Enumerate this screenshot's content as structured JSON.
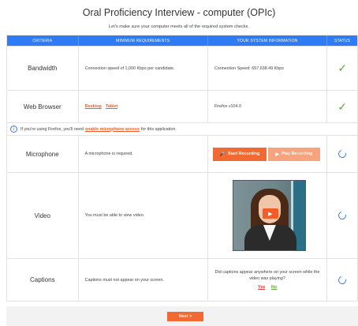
{
  "page": {
    "title": "Oral Proficiency Interview - computer (OPIc)",
    "subtitle": "Let's make sure your computer meets all of the required system checks."
  },
  "table": {
    "headers": {
      "criteria": "CRITERIA",
      "requirements": "MINIMUM REQUIREMENTS",
      "system_info": "YOUR SYSTEM INFORMATION",
      "status": "STATUS"
    },
    "bandwidth": {
      "criteria": "Bandwidth",
      "requirement": "Connection speed of 1,000 Kbps per candidate.",
      "info": "Connection Speed: 657,638.49 Kbps",
      "status_icon": "check-icon"
    },
    "browser": {
      "criteria": "Web Browser",
      "link_desktop": "Desktop",
      "link_tablet": "Tablet",
      "info": "Firefox v104.0",
      "status_icon": "check-icon"
    },
    "firefox_note": {
      "prefix": "If you're using Firefox, you'll need",
      "link": "enable microphone access",
      "suffix": "for this application."
    },
    "microphone": {
      "criteria": "Microphone",
      "requirement": "A microphone is required.",
      "start_recording": "Start Recording",
      "play_recording": "Play Recording",
      "status_icon": "loading-icon"
    },
    "video": {
      "criteria": "Video",
      "requirement": "You must be able to view video.",
      "status_icon": "loading-icon"
    },
    "captions": {
      "criteria": "Captions",
      "requirement": "Captions must not appear on your screen.",
      "question": "Did captions appear anywhere on your screen while the video was playing?",
      "yes": "Yes",
      "no": "No",
      "status_icon": "loading-icon"
    }
  },
  "footer": {
    "next_label": "Next >"
  },
  "colors": {
    "header_blue": "#2f7bf5",
    "accent_orange": "#f26a32",
    "check_green": "#5fae3a"
  }
}
